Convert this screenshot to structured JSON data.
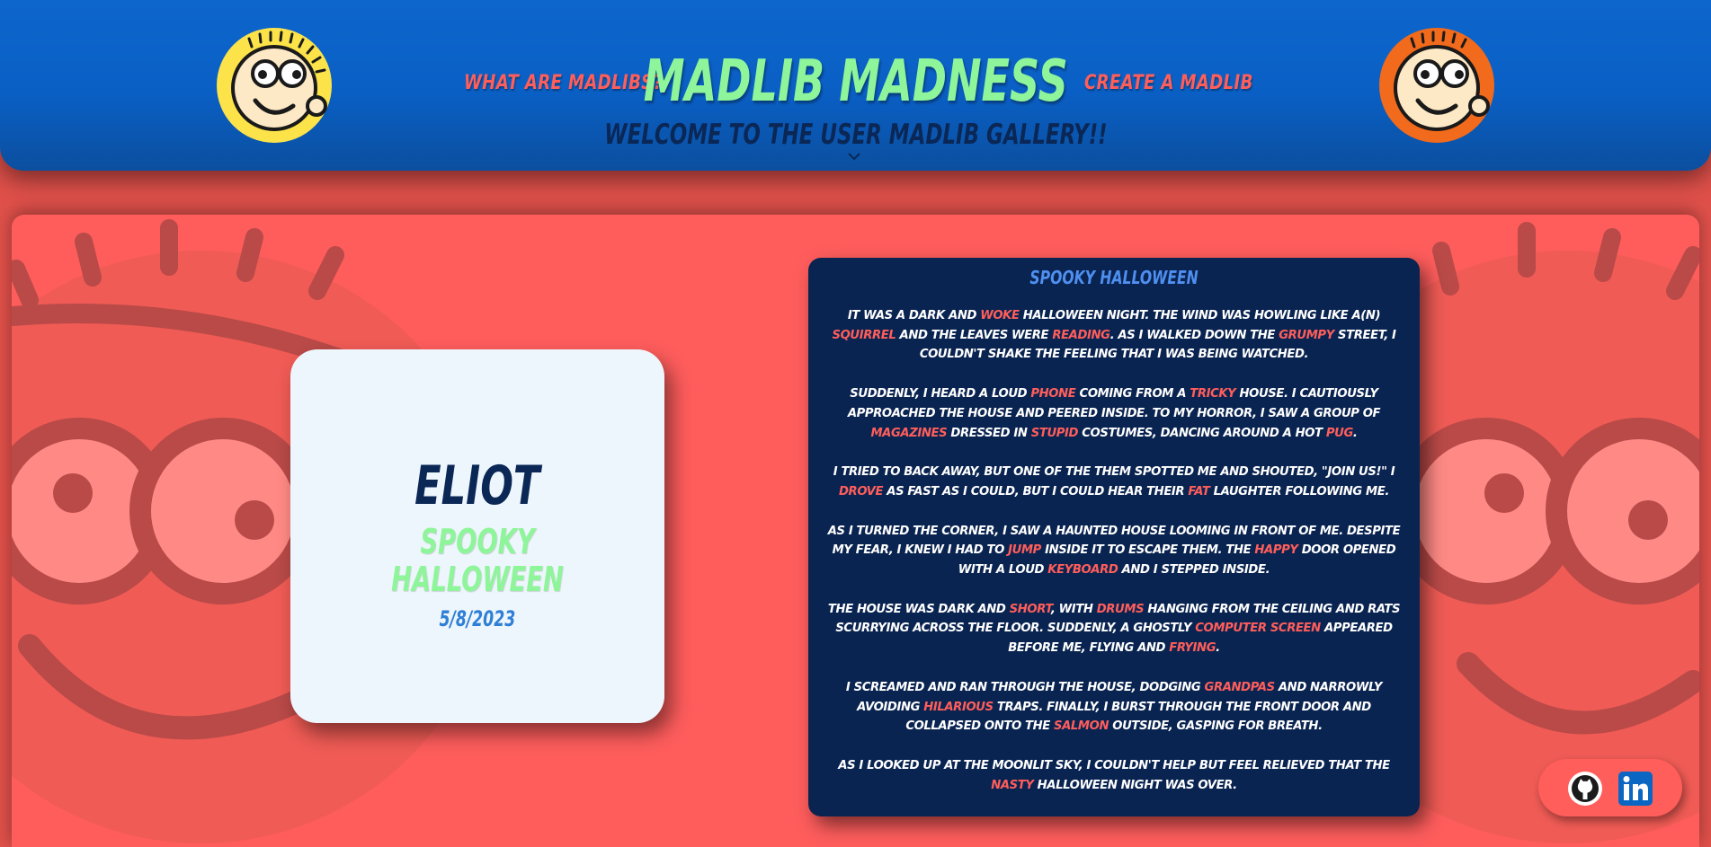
{
  "header": {
    "site_title": "MADLIB MADNESS",
    "nav_left": "WHAT ARE MADLIBS?",
    "nav_right": "CREATE A MADLIB",
    "gallery_title": "WELCOME TO THE USER MADLIB GALLERY!!",
    "left_avatar_icon": "smiley-face-icon",
    "right_avatar_icon": "smiley-face-icon",
    "expand_icon": "chevron-down-icon"
  },
  "card": {
    "name": "ELIOT",
    "title": "SPOOKY HALLOWEEN",
    "date": "5/8/2023"
  },
  "story": {
    "title": "SPOOKY HALLOWEEN",
    "paragraphs": [
      [
        [
          "t",
          "IT WAS A DARK AND "
        ],
        [
          "w",
          "WOKE"
        ],
        [
          "t",
          " HALLOWEEN NIGHT. THE WIND WAS HOWLING LIKE A(N) "
        ],
        [
          "w",
          "SQUIRREL"
        ],
        [
          "t",
          " AND THE LEAVES WERE "
        ],
        [
          "w",
          "READING"
        ],
        [
          "t",
          ". AS I WALKED DOWN THE "
        ],
        [
          "w",
          "GRUMPY"
        ],
        [
          "t",
          " STREET, I COULDN'T SHAKE THE FEELING THAT I WAS BEING WATCHED."
        ]
      ],
      [
        [
          "t",
          "SUDDENLY, I HEARD A LOUD "
        ],
        [
          "w",
          "PHONE"
        ],
        [
          "t",
          " COMING FROM A "
        ],
        [
          "w",
          "TRICKY"
        ],
        [
          "t",
          " HOUSE. I CAUTIOUSLY APPROACHED THE HOUSE AND PEERED INSIDE. TO MY HORROR, I SAW A GROUP OF "
        ],
        [
          "w",
          "MAGAZINES"
        ],
        [
          "t",
          " DRESSED IN "
        ],
        [
          "w",
          "STUPID"
        ],
        [
          "t",
          " COSTUMES, DANCING AROUND A HOT "
        ],
        [
          "w",
          "PUG"
        ],
        [
          "t",
          "."
        ]
      ],
      [
        [
          "t",
          "I TRIED TO BACK AWAY, BUT ONE OF THE THEM SPOTTED ME AND SHOUTED, \"JOIN US!\" I "
        ],
        [
          "w",
          "DROVE"
        ],
        [
          "t",
          " AS FAST AS I COULD, BUT I COULD HEAR THEIR "
        ],
        [
          "w",
          "FAT"
        ],
        [
          "t",
          " LAUGHTER FOLLOWING ME."
        ]
      ],
      [
        [
          "t",
          "AS I TURNED THE CORNER, I SAW A HAUNTED HOUSE LOOMING IN FRONT OF ME. DESPITE MY FEAR, I KNEW I HAD TO "
        ],
        [
          "w",
          "JUMP"
        ],
        [
          "t",
          " INSIDE IT TO ESCAPE THEM. THE "
        ],
        [
          "w",
          "HAPPY"
        ],
        [
          "t",
          " DOOR OPENED WITH A LOUD "
        ],
        [
          "w",
          "KEYBOARD"
        ],
        [
          "t",
          " AND I STEPPED INSIDE."
        ]
      ],
      [
        [
          "t",
          "THE HOUSE WAS DARK AND "
        ],
        [
          "w",
          "SHORT"
        ],
        [
          "t",
          ", WITH "
        ],
        [
          "w",
          "DRUMS"
        ],
        [
          "t",
          " HANGING FROM THE CEILING AND RATS SCURRYING ACROSS THE FLOOR. SUDDENLY, A GHOSTLY "
        ],
        [
          "w",
          "COMPUTER SCREEN"
        ],
        [
          "t",
          " APPEARED BEFORE ME, FLYING AND "
        ],
        [
          "w",
          "FRYING"
        ],
        [
          "t",
          "."
        ]
      ],
      [
        [
          "t",
          "I SCREAMED AND RAN THROUGH THE HOUSE, DODGING "
        ],
        [
          "w",
          "GRANDPAS"
        ],
        [
          "t",
          " AND NARROWLY AVOIDING "
        ],
        [
          "w",
          "HILARIOUS"
        ],
        [
          "t",
          " TRAPS. FINALLY, I BURST THROUGH THE FRONT DOOR AND COLLAPSED ONTO THE "
        ],
        [
          "w",
          "SALMON"
        ],
        [
          "t",
          " OUTSIDE, GASPING FOR BREATH."
        ]
      ],
      [
        [
          "t",
          "AS I LOOKED UP AT THE MOONLIT SKY, I COULDN'T HELP BUT FEEL RELIEVED THAT THE "
        ],
        [
          "w",
          "NASTY"
        ],
        [
          "t",
          " HALLOWEEN NIGHT WAS OVER."
        ]
      ]
    ]
  },
  "social": {
    "github_icon": "github-icon",
    "linkedin_icon": "linkedin-icon"
  },
  "colors": {
    "header_blue": "#0a5fc4",
    "title_green": "#8ff59a",
    "accent_red": "#ff5e5b",
    "navy": "#0a2451"
  }
}
